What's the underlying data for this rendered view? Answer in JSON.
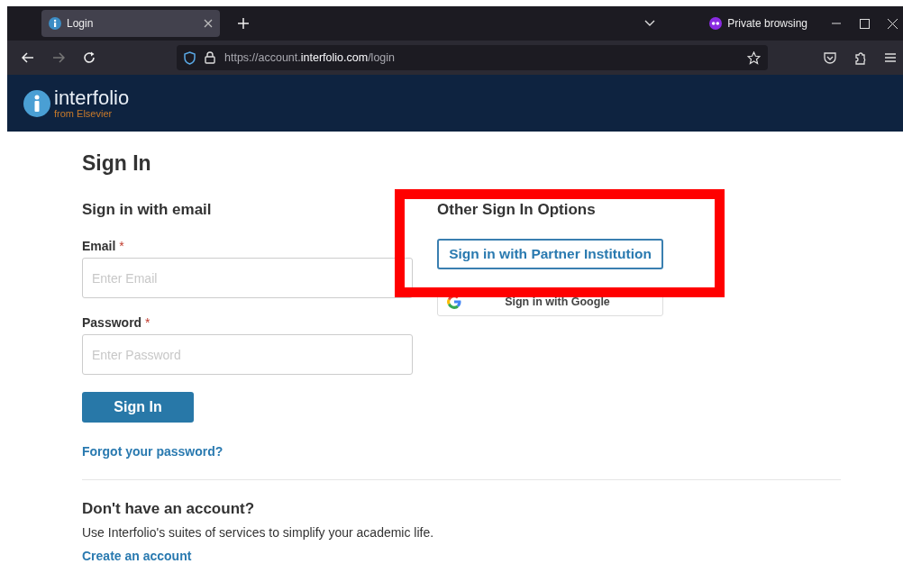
{
  "browser": {
    "tabs": [
      {
        "title": "Login",
        "selected": true
      }
    ],
    "private_label": "Private browsing",
    "url": "https://account.**interfolio.com**/login"
  },
  "header": {
    "logo_name": "interfolio",
    "logo_sub": "from Elsevier"
  },
  "sign_in": {
    "title": "Sign In",
    "email_section": {
      "heading": "Sign in with email",
      "fields": [
        {
          "label": "Email",
          "required_mark": "*",
          "placeholder": "Enter Email"
        },
        {
          "label": "Password",
          "required_mark": "*",
          "placeholder": "Enter Password"
        }
      ],
      "button": "Sign In",
      "forgot_link": "Forgot your password?"
    },
    "other_options": {
      "heading": "Other Sign In Options",
      "buttons": [
        {
          "label": "Sign in with Partner Institution",
          "kind": "partner"
        },
        {
          "label": "Sign in with Google",
          "kind": "google"
        }
      ]
    },
    "signup": {
      "heading": "Don't have an account?",
      "text": "Use Interfolio's suites of services to simplify your academic life.",
      "link": "Create an account"
    }
  },
  "annotation": {
    "kind": "highlight-rectangle"
  }
}
